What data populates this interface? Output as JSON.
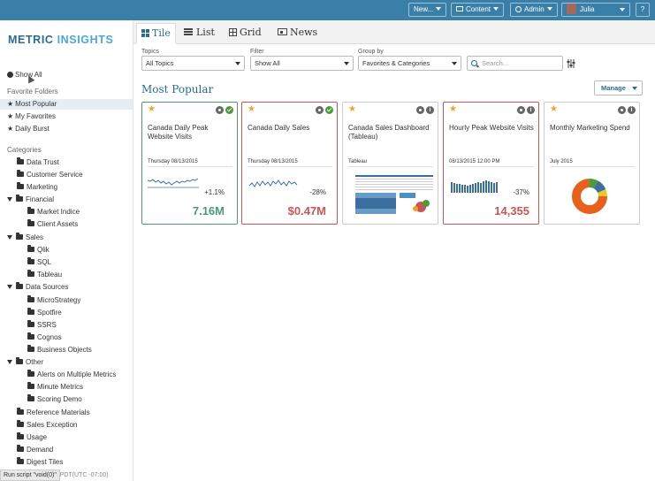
{
  "topbar": {
    "new_label": "New...",
    "content_label": "Content",
    "admin_label": "Admin",
    "user_label": "Julia",
    "help_label": "?"
  },
  "brand": {
    "part1": "METRIC ",
    "part2": "INSIGHTS"
  },
  "sidebar": {
    "show_all": "Show All",
    "favorite_folders_heading": "Favorite Folders",
    "favorites": [
      "Most Popular",
      "My Favorites",
      "Daily Burst"
    ],
    "categories_heading": "Categories",
    "categories": [
      "Data Trust",
      "Customer Service",
      "Marketing",
      "Financial",
      "Market Indice",
      "Client Assets",
      "Sales",
      "Qlik",
      "SQL",
      "Tableau",
      "Data Sources",
      "MicroStrategy",
      "Spotfire",
      "SSRS",
      "Cognos",
      "Business Objects",
      "Other",
      "Alerts on Multiple Metrics",
      "Minute Metrics",
      "Scoring Demo",
      "Reference Materials",
      "Sales Exception",
      "Usage",
      "Demand",
      "Digest Tiles"
    ]
  },
  "status_bar": {
    "text": "Run script \"void(0)\"",
    "time_fragment": "49 PDT(UTC -07:00)"
  },
  "tabs": [
    "Tile",
    "List",
    "Grid",
    "News"
  ],
  "filters": {
    "topics_label": "Topics",
    "topics_value": "All Topics",
    "filter_label": "Filter",
    "filter_value": "Show All",
    "groupby_label": "Group by",
    "groupby_value": "Favorites & Categories",
    "search_placeholder": "Search..."
  },
  "section": {
    "title": "Most Popular",
    "manage_label": "Manage"
  },
  "tiles": [
    {
      "title": "Canada Daily Peak Website Visits",
      "date": "Thursday 08/13/2015",
      "change": "+1.1%",
      "value": "7.16M",
      "status": "green",
      "indicator": "check"
    },
    {
      "title": "Canada Daily Sales",
      "date": "Thursday 08/13/2015",
      "change": "-28%",
      "value": "$0.47M",
      "status": "red",
      "indicator": "check"
    },
    {
      "title": "Canada Sales Dashboard (Tableau)",
      "date": "Tableau",
      "change": "",
      "value": "",
      "status": "neutral",
      "indicator": "info"
    },
    {
      "title": "Hourly Peak Website Visits",
      "date": "08/13/2015 12:00 PM",
      "change": "-37%",
      "value": "14,355",
      "status": "red",
      "indicator": "info"
    },
    {
      "title": "Monthly Marketing Spend",
      "date": "July 2015",
      "change": "",
      "value": "",
      "status": "neutral",
      "indicator": "info"
    }
  ],
  "colors": {
    "brand_blue": "#2a6b96",
    "topbar": "#3a7fa8",
    "green": "#4c9a74",
    "red": "#c95555",
    "star": "#f0a224"
  }
}
